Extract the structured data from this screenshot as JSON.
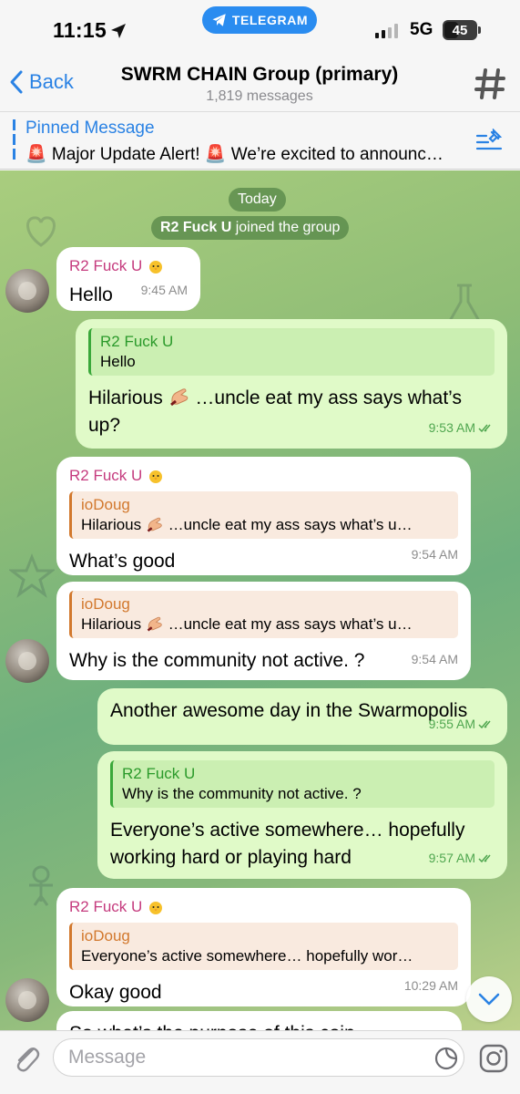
{
  "status": {
    "time": "11:15",
    "app_pill": "TELEGRAM",
    "network": "5G",
    "battery": "45"
  },
  "header": {
    "back_label": "Back",
    "title": "SWRM CHAIN Group (primary)",
    "subtitle": "1,819 messages"
  },
  "pinned": {
    "title": "Pinned Message",
    "text": "🚨 Major Update Alert! 🚨 We’re excited to announc…"
  },
  "service": {
    "date": "Today",
    "join_name": "R2 Fuck U",
    "join_text": " joined the group"
  },
  "messages": [
    {
      "dir": "in",
      "sender": "R2 Fuck U",
      "text": "Hello",
      "time": "9:45 AM"
    },
    {
      "dir": "out",
      "reply_name": "R2 Fuck U",
      "reply_text": "Hello",
      "text_a": "Hilarious",
      "text_b": " …uncle eat my ass says what’s up?",
      "time": "9:53 AM"
    },
    {
      "dir": "in",
      "sender": "R2 Fuck U",
      "reply_name": "ioDoug",
      "reply_text_a": "Hilarious",
      "reply_text_b": " …uncle eat my ass says what’s u…",
      "text": "What’s good",
      "time": "9:54 AM"
    },
    {
      "dir": "in",
      "reply_name": "ioDoug",
      "reply_text_a": "Hilarious",
      "reply_text_b": " …uncle eat my ass says what’s u…",
      "text": "Why is the community not active. ?",
      "time": "9:54 AM"
    },
    {
      "dir": "out",
      "text": "Another awesome day in the Swarmopolis",
      "time": "9:55 AM"
    },
    {
      "dir": "out",
      "reply_name": "R2 Fuck U",
      "reply_text": "Why is the community not active. ?",
      "text": "Everyone’s active somewhere… hopefully working hard or playing hard",
      "time": "9:57 AM"
    },
    {
      "dir": "in",
      "sender": "R2 Fuck U",
      "reply_name": "ioDoug",
      "reply_text": "Everyone’s active somewhere… hopefully wor…",
      "text": "Okay good",
      "time": "10:29 AM"
    },
    {
      "dir": "in",
      "text": "So what’s the purpose of this coin"
    }
  ],
  "input": {
    "placeholder": "Message"
  },
  "icons": {
    "location": "location-arrow-icon",
    "telegram": "telegram-plane-icon",
    "back": "chevron-left-icon",
    "group": "hashtag-icon",
    "pinned_list": "pin-list-icon",
    "attach": "paperclip-icon",
    "sticker": "sticker-icon",
    "camera": "instagram-camera-icon",
    "scroll": "chevron-down-icon",
    "sender_emoji": "chick-emoji-icon",
    "message_emoji": "pinching-hand-emoji-icon"
  },
  "colors": {
    "accent": "#2a82e4",
    "outgoing": "#e0fac8",
    "incoming": "#ffffff",
    "sender": "#c53b7e",
    "reply_green": "#2b9a2b",
    "reply_orange": "#d2782d"
  }
}
